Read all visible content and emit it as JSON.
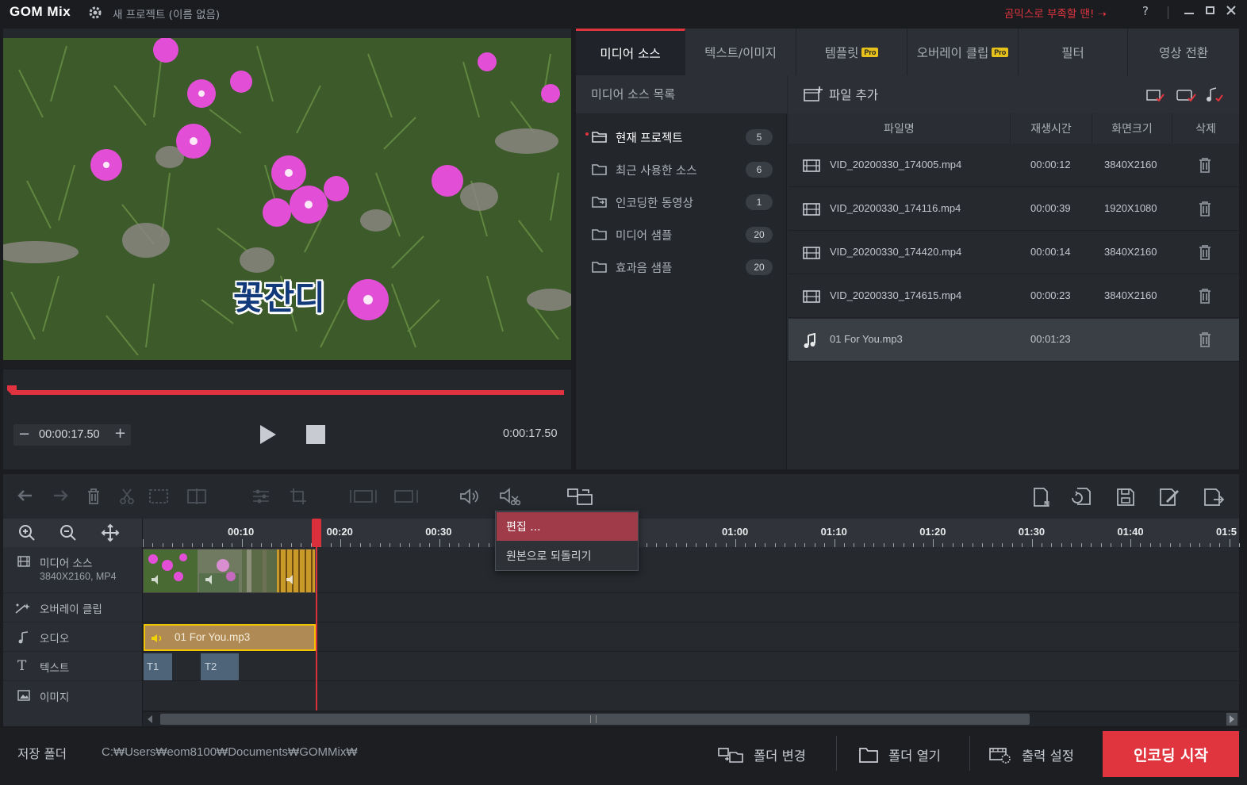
{
  "app": {
    "logo": "GOM Mix",
    "project_title": "새 프로젝트 (이름 없음)",
    "promo": "곰믹스로 부족할 땐! ➝",
    "help": "?"
  },
  "preview": {
    "caption": "꽃잔디",
    "current_time": "00:00:17.50",
    "total_time": "0:00:17.50",
    "minus": "−",
    "plus": "+"
  },
  "tabs": [
    {
      "label": "미디어 소스",
      "pro": false
    },
    {
      "label": "텍스트/이미지",
      "pro": false
    },
    {
      "label": "템플릿",
      "pro": true
    },
    {
      "label": "오버레이 클립",
      "pro": true
    },
    {
      "label": "필터",
      "pro": false
    },
    {
      "label": "영상 전환",
      "pro": false
    }
  ],
  "pro_badge": "Pro",
  "media": {
    "list_title": "미디어 소스 목록",
    "folders": [
      {
        "label": "현재 프로젝트",
        "count": "5"
      },
      {
        "label": "최근 사용한 소스",
        "count": "6"
      },
      {
        "label": "인코딩한 동영상",
        "count": "1"
      },
      {
        "label": "미디어 샘플",
        "count": "20"
      },
      {
        "label": "효과음 샘플",
        "count": "20"
      }
    ],
    "add_file": "파일 추가",
    "columns": {
      "name": "파일명",
      "duration": "재생시간",
      "resolution": "화면크기",
      "delete": "삭제"
    },
    "files": [
      {
        "name": "VID_20200330_174005.mp4",
        "duration": "00:00:12",
        "resolution": "3840X2160",
        "type": "video"
      },
      {
        "name": "VID_20200330_174116.mp4",
        "duration": "00:00:39",
        "resolution": "1920X1080",
        "type": "video"
      },
      {
        "name": "VID_20200330_174420.mp4",
        "duration": "00:00:14",
        "resolution": "3840X2160",
        "type": "video"
      },
      {
        "name": "VID_20200330_174615.mp4",
        "duration": "00:00:23",
        "resolution": "3840X2160",
        "type": "video"
      },
      {
        "name": "01 For You.mp3",
        "duration": "00:01:23",
        "resolution": "",
        "type": "audio"
      }
    ]
  },
  "timeline": {
    "ruler": [
      "00:10",
      "00:20",
      "00:30",
      "",
      "50",
      "01:00",
      "01:10",
      "01:20",
      "01:30",
      "01:40",
      "01:5"
    ],
    "tracks": [
      {
        "label": "미디어 소스",
        "sub": "3840X2160, MP4"
      },
      {
        "label": "오버레이 클립",
        "sub": ""
      },
      {
        "label": "오디오",
        "sub": ""
      },
      {
        "label": "텍스트",
        "sub": ""
      },
      {
        "label": "이미지",
        "sub": ""
      }
    ],
    "audio_clip": "01 For You.mp3",
    "text_clips": [
      "T1",
      "T2"
    ],
    "context_menu": [
      "편집 ...",
      "원본으로 되돌리기"
    ]
  },
  "bottom": {
    "save_folder_label": "저장 폴더",
    "save_path": "C:₩Users₩eom8100₩Documents₩GOMMix₩",
    "change_folder": "폴더 변경",
    "open_folder": "폴더 열기",
    "output_settings": "출력 설정",
    "encode": "인코딩 시작"
  },
  "colors": {
    "accent": "#e0343f",
    "pro": "#e7c11b",
    "audio_clip": "#b08a55"
  }
}
